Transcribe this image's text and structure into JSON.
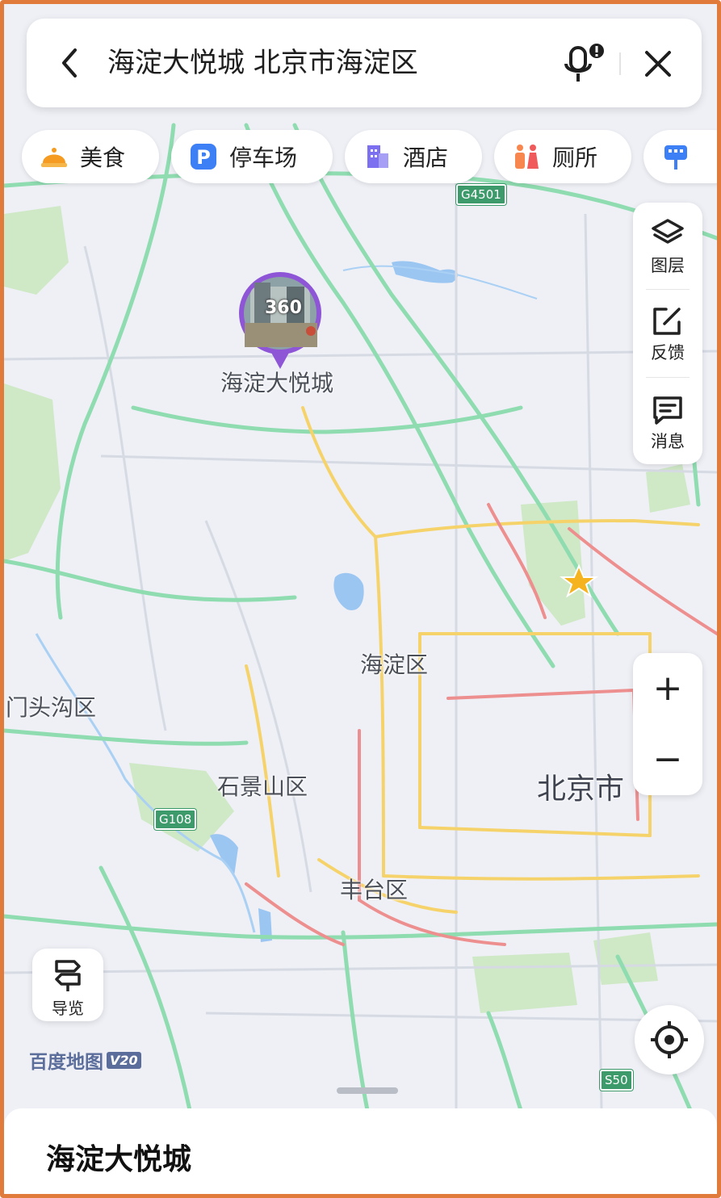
{
  "search": {
    "query": "海淀大悦城 北京市海淀区"
  },
  "categories": [
    {
      "label": "美食",
      "icon": "food-icon"
    },
    {
      "label": "停车场",
      "icon": "parking-icon"
    },
    {
      "label": "酒店",
      "icon": "hotel-icon"
    },
    {
      "label": "厕所",
      "icon": "toilet-icon"
    }
  ],
  "controls": {
    "layers_label": "图层",
    "feedback_label": "反馈",
    "messages_label": "消息",
    "zoom_in": "+",
    "zoom_out": "−",
    "guide_label": "导览"
  },
  "map": {
    "poi_name": "海淀大悦城",
    "poi_badge": "360",
    "districts": {
      "haidian": "海淀区",
      "mentougou": "门头沟区",
      "shijingshan": "石景山区",
      "beijing": "北京市",
      "fengtai": "丰台区"
    },
    "roads": {
      "g4501": "G4501",
      "g108": "G108",
      "s50": "S50"
    },
    "logo_text": "百度地图",
    "logo_version": "V20"
  },
  "bottom_sheet": {
    "title": "海淀大悦城"
  },
  "colors": {
    "frame": "#e07b3c",
    "road_green": "#8fdcb0",
    "road_yellow": "#f6d36a",
    "road_red": "#ee8f8f",
    "poi_purple": "#8e56d6",
    "park_green": "#cfe8c6",
    "water_blue": "#9cc6f2"
  }
}
